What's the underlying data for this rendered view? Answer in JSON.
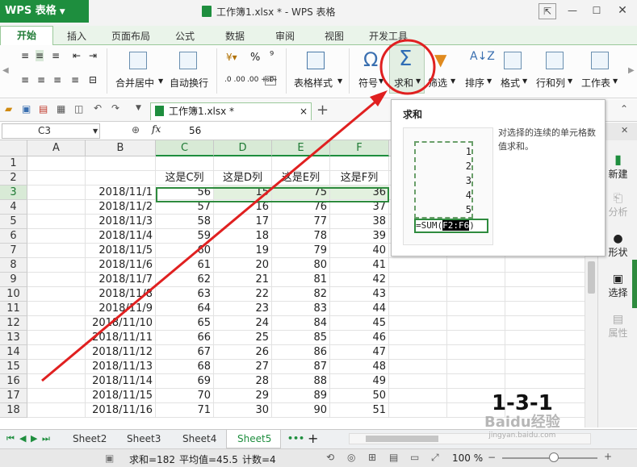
{
  "app": {
    "logo": "WPS 表格",
    "title": "工作簿1.xlsx * - WPS 表格"
  },
  "ribbon_tabs": [
    "开始",
    "插入",
    "页面布局",
    "公式",
    "数据",
    "审阅",
    "视图",
    "开发工具"
  ],
  "ribbon": {
    "merge_center": "合并居中",
    "wrap_text": "自动换行",
    "table_style": "表格样式",
    "symbol": "符号",
    "sum": "求和",
    "filter": "筛选",
    "sort": "排序",
    "format": "格式",
    "rows_cols": "行和列",
    "worksheet": "工作表",
    "percent": "%",
    "comma": "⁹",
    "dec_inc": ".0 .00",
    "dec_dec": ".00 +.0"
  },
  "doc_tab": "工作簿1.xlsx *",
  "formula_bar": {
    "name_box": "C3",
    "fx": "fx",
    "value": "56"
  },
  "columns": [
    "A",
    "B",
    "C",
    "D",
    "E",
    "F"
  ],
  "rows": [
    {
      "n": "1",
      "b": "",
      "c": "",
      "d": "",
      "e": "",
      "f": ""
    },
    {
      "n": "2",
      "b": "",
      "c": "这是C列",
      "d": "这是D列",
      "e": "这是E列",
      "f": "这是F列"
    },
    {
      "n": "3",
      "b": "2018/11/1",
      "c": "56",
      "d": "15",
      "e": "75",
      "f": "36"
    },
    {
      "n": "4",
      "b": "2018/11/2",
      "c": "57",
      "d": "16",
      "e": "76",
      "f": "37"
    },
    {
      "n": "5",
      "b": "2018/11/3",
      "c": "58",
      "d": "17",
      "e": "77",
      "f": "38"
    },
    {
      "n": "6",
      "b": "2018/11/4",
      "c": "59",
      "d": "18",
      "e": "78",
      "f": "39"
    },
    {
      "n": "7",
      "b": "2018/11/5",
      "c": "60",
      "d": "19",
      "e": "79",
      "f": "40"
    },
    {
      "n": "8",
      "b": "2018/11/6",
      "c": "61",
      "d": "20",
      "e": "80",
      "f": "41"
    },
    {
      "n": "9",
      "b": "2018/11/7",
      "c": "62",
      "d": "21",
      "e": "81",
      "f": "42"
    },
    {
      "n": "10",
      "b": "2018/11/8",
      "c": "63",
      "d": "22",
      "e": "82",
      "f": "43"
    },
    {
      "n": "11",
      "b": "2018/11/9",
      "c": "64",
      "d": "23",
      "e": "83",
      "f": "44"
    },
    {
      "n": "12",
      "b": "2018/11/10",
      "c": "65",
      "d": "24",
      "e": "84",
      "f": "45"
    },
    {
      "n": "13",
      "b": "2018/11/11",
      "c": "66",
      "d": "25",
      "e": "85",
      "f": "46"
    },
    {
      "n": "14",
      "b": "2018/11/12",
      "c": "67",
      "d": "26",
      "e": "86",
      "f": "47"
    },
    {
      "n": "15",
      "b": "2018/11/13",
      "c": "68",
      "d": "27",
      "e": "87",
      "f": "48"
    },
    {
      "n": "16",
      "b": "2018/11/14",
      "c": "69",
      "d": "28",
      "e": "88",
      "f": "49"
    },
    {
      "n": "17",
      "b": "2018/11/15",
      "c": "70",
      "d": "29",
      "e": "89",
      "f": "50"
    },
    {
      "n": "18",
      "b": "2018/11/16",
      "c": "71",
      "d": "30",
      "e": "90",
      "f": "51"
    }
  ],
  "tooltip": {
    "title": "求和",
    "desc": "对选择的连续的单元格数值求和。",
    "values": [
      "1",
      "2",
      "3",
      "4",
      "5"
    ],
    "formula_prefix": "=SUM(",
    "formula_ref": "F2:F6",
    "formula_suffix": ")"
  },
  "side_panel": [
    "新建",
    "分析",
    "形状",
    "选择",
    "属性"
  ],
  "sheet_tabs": [
    "Sheet2",
    "Sheet3",
    "Sheet4",
    "Sheet5"
  ],
  "sheet_more": "•••",
  "status": {
    "sum": "求和=182",
    "avg": "平均值=45.5",
    "count": "计数=4",
    "zoom": "100 %"
  },
  "watermark": {
    "step": "1-3-1",
    "brand": "Baidu经验",
    "site": "jingyan.baidu.com"
  },
  "colors": {
    "accent": "#1e8e3e",
    "annotation": "#e02020"
  }
}
